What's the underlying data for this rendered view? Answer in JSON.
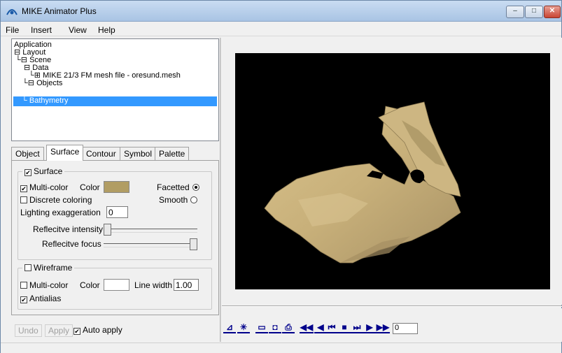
{
  "window": {
    "title": "MIKE Animator Plus",
    "minimize": "–",
    "maximize": "□",
    "close": "✕"
  },
  "menu": [
    "File",
    "Insert",
    "View",
    "Help"
  ],
  "tree": {
    "items": [
      {
        "prefix": "",
        "label": "Application"
      },
      {
        "prefix": "⊟ ",
        "label": "Layout"
      },
      {
        "prefix": "└⊟ ",
        "label": "Scene"
      },
      {
        "prefix": "⊟ ",
        "label": "Data"
      },
      {
        "prefix": "└⊞ ",
        "label": "MIKE 21/3 FM mesh file - oresund.mesh"
      },
      {
        "prefix": "└⊟ ",
        "label": "Objects"
      },
      {
        "prefix": "└ ",
        "label": "Bathymetry"
      }
    ]
  },
  "tabs": [
    "Object",
    "Surface",
    "Contour",
    "Symbol",
    "Palette"
  ],
  "active_tab": "Surface",
  "surface": {
    "group_label": "Surface",
    "group_checked": true,
    "multicolor_label": "Multi-color",
    "multicolor_checked": true,
    "color_label": "Color",
    "color_value": "#b19d64",
    "facetted_label": "Facetted",
    "facetted_selected": true,
    "discrete_label": "Discrete coloring",
    "discrete_checked": false,
    "smooth_label": "Smooth",
    "smooth_selected": false,
    "lighting_label": "Lighting exaggeration",
    "lighting_value": "0",
    "reflective_intensity_label": "Reflecitve intensity",
    "reflective_intensity_level": 0.0,
    "reflective_focus_label": "Reflecitve focus",
    "reflective_focus_level": 1.0
  },
  "wireframe": {
    "group_label": "Wireframe",
    "group_checked": false,
    "multicolor_label": "Multi-color",
    "multicolor_checked": false,
    "color_label": "Color",
    "color_value": "#ffffff",
    "line_width_label": "Line width",
    "line_width_value": "1.00",
    "antialias_label": "Antialias",
    "antialias_checked": true
  },
  "bottom": {
    "undo": "Undo",
    "apply": "Apply",
    "auto_apply": "Auto apply",
    "auto_apply_checked": true
  },
  "toolbar": {
    "icons": [
      {
        "name": "chart-icon",
        "glyph": "⊿"
      },
      {
        "name": "asterisk-icon",
        "glyph": "✳"
      },
      {
        "name": "camera-icon",
        "glyph": "▭"
      },
      {
        "name": "photo-camera-icon",
        "glyph": "◘"
      },
      {
        "name": "printer-icon",
        "glyph": "⎙"
      },
      {
        "name": "rewind-icon",
        "glyph": "◀◀"
      },
      {
        "name": "step-back-icon",
        "glyph": "◀"
      },
      {
        "name": "first-frame-icon",
        "glyph": "⏮"
      },
      {
        "name": "stop-icon",
        "glyph": "■"
      },
      {
        "name": "last-frame-icon",
        "glyph": "⏭"
      },
      {
        "name": "step-forward-icon",
        "glyph": "▶"
      },
      {
        "name": "fast-forward-icon",
        "glyph": "▶▶"
      }
    ],
    "frame_value": "0"
  },
  "colors": {
    "viewport_bg": "#000000",
    "terrain": "#c8b07a",
    "selection": "#3399ff"
  }
}
